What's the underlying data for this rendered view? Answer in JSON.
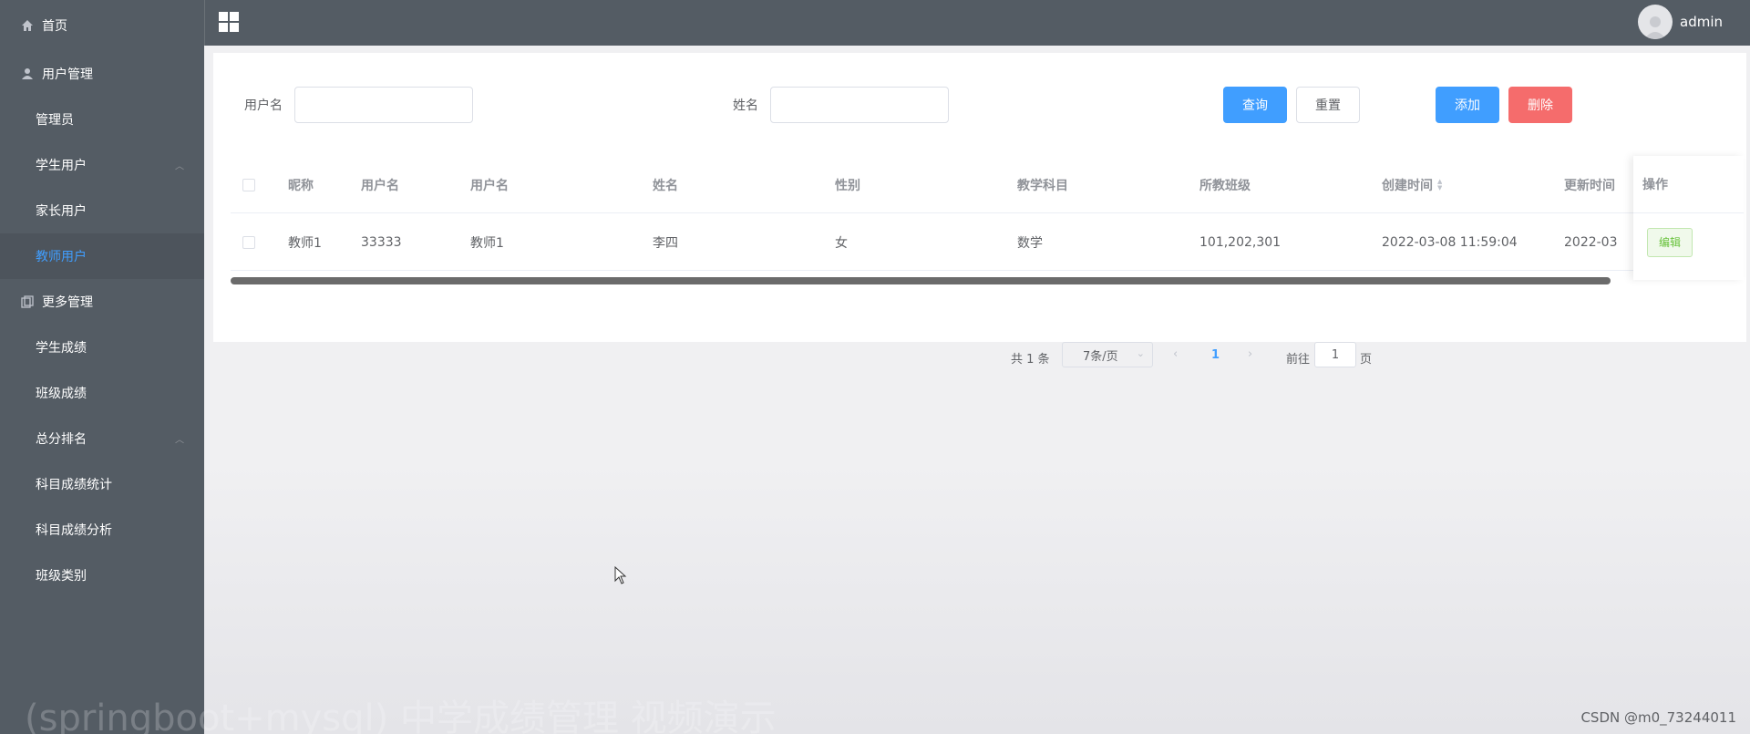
{
  "sidebar": {
    "home": "首页",
    "group1": {
      "label": "用户管理",
      "items": [
        "管理员",
        "学生用户",
        "家长用户",
        "教师用户"
      ],
      "active_index": 3
    },
    "group2": {
      "label": "更多管理",
      "items": [
        "学生成绩",
        "班级成绩",
        "总分排名",
        "科目成绩统计",
        "科目成绩分析",
        "班级类别"
      ]
    }
  },
  "header": {
    "username": "admin"
  },
  "search": {
    "username_label": "用户名",
    "username_value": "",
    "name_label": "姓名",
    "name_value": "",
    "query_label": "查询",
    "reset_label": "重置",
    "add_label": "添加",
    "delete_label": "删除"
  },
  "table": {
    "columns": [
      "昵称",
      "用户名",
      "用户名",
      "姓名",
      "性别",
      "教学科目",
      "所教班级",
      "创建时间",
      "更新时间"
    ],
    "action_header": "操作",
    "rows": [
      [
        "教师1",
        "33333",
        "教师1",
        "李四",
        "女",
        "数学",
        "101,202,301",
        "2022-03-08 11:59:04",
        "2022-03"
      ]
    ],
    "edit_label": "编辑"
  },
  "pagination": {
    "total": "共 1 条",
    "page_size": "7条/页",
    "current_page": "1",
    "goto_label": "前往",
    "goto_value": "1",
    "page_unit": "页"
  },
  "overlay": {
    "watermark": "(springboot+mysql) 中学成绩管理 视频演示",
    "csdn": "CSDN @m0_73244011"
  },
  "colors": {
    "sidebar_bg": "#545c64",
    "active": "#409EFF",
    "danger": "#F56C6C",
    "success": "#67c23a"
  }
}
